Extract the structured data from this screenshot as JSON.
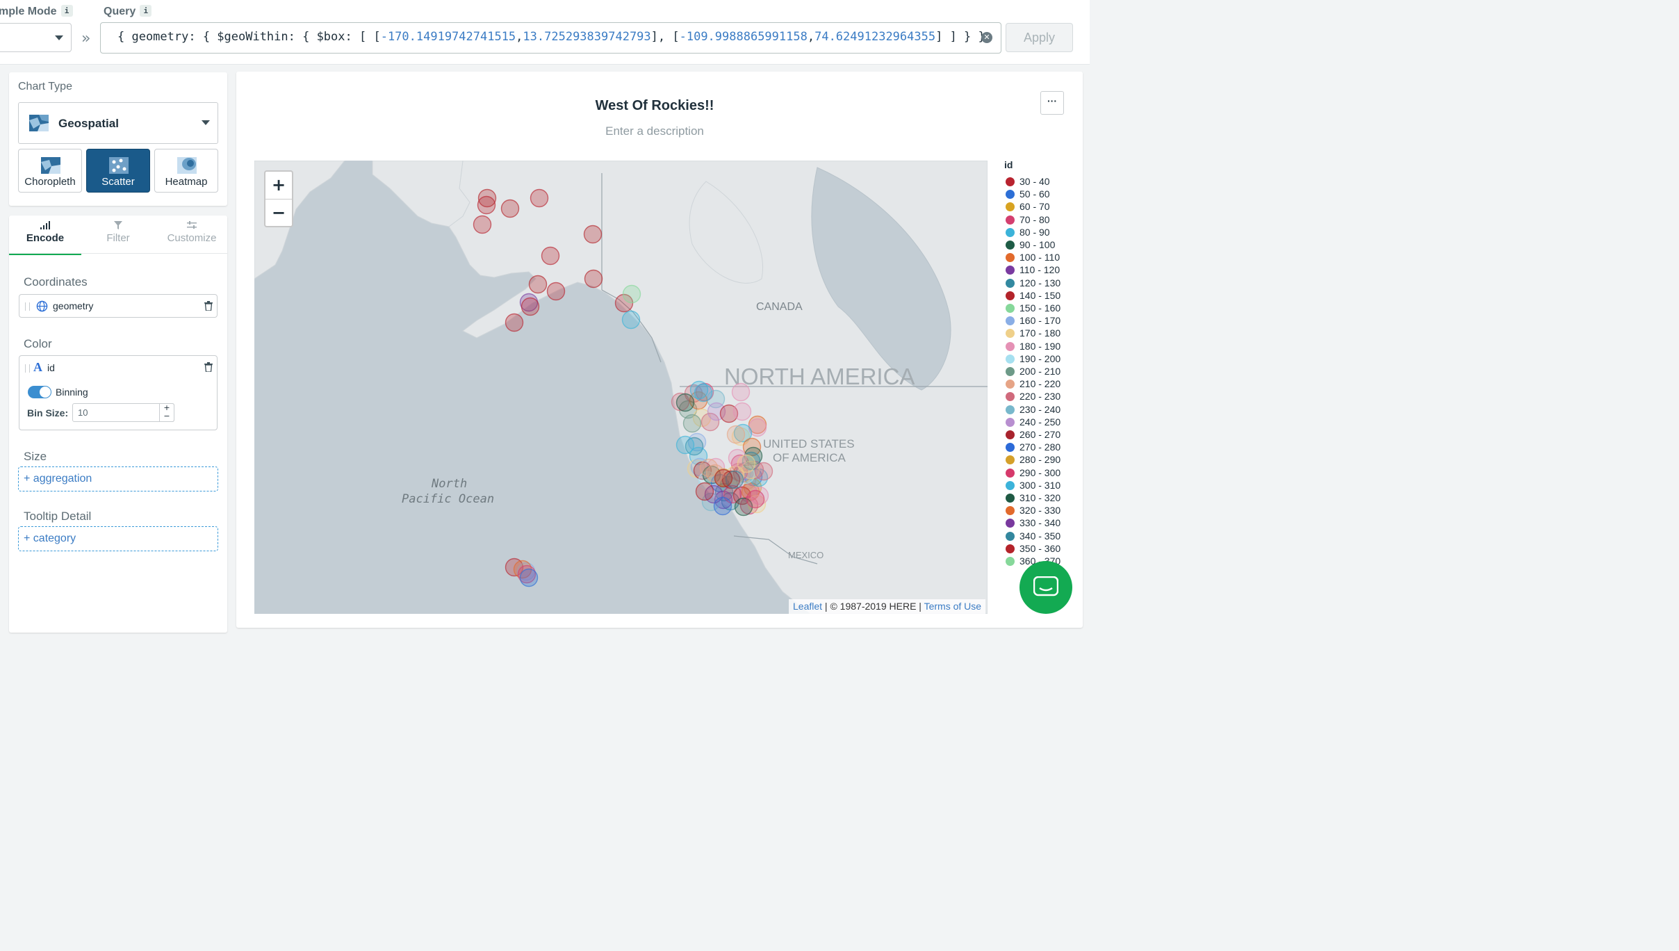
{
  "topbar": {
    "sample_mode_label": "mple Mode",
    "query_label": "Query",
    "info_glyph": "i",
    "query_text": "{ geometry: { $geoWithin: { $box: [ [",
    "query_num1": "-170.14919742741515",
    "query_num2": "13.725293839742793",
    "query_mid": "], [",
    "query_num3": "-109.9988865991158",
    "query_num4": "74.62491232964355",
    "query_end": "] ] } }",
    "apply_label": "Apply"
  },
  "chart_type": {
    "title": "Chart Type",
    "selected": "Geospatial",
    "options": [
      "Choropleth",
      "Scatter",
      "Heatmap"
    ],
    "active": "Scatter"
  },
  "tabs": [
    {
      "label": "Encode"
    },
    {
      "label": "Filter"
    },
    {
      "label": "Customize"
    }
  ],
  "encode": {
    "coordinates_title": "Coordinates",
    "coordinates_field": "geometry",
    "color_title": "Color",
    "color_field": "id",
    "binning_label": "Binning",
    "bin_size_label": "Bin Size:",
    "bin_size_value": "10",
    "size_title": "Size",
    "size_placeholder": "+ aggregation",
    "tooltip_title": "Tooltip Detail",
    "tooltip_placeholder": "+ category"
  },
  "chart": {
    "title": "West Of Rockies!!",
    "description_placeholder": "Enter a description",
    "more_label": "···",
    "map_labels": {
      "canada": "CANADA",
      "north_america": "NORTH AMERICA",
      "usa_1": "UNITED STATES",
      "usa_2": "OF AMERICA",
      "mexico": "MEXICO",
      "ocean_1": "North",
      "ocean_2": "Pacific Ocean"
    },
    "zoom_in": "+",
    "zoom_out": "−",
    "attribution_leaflet": "Leaflet",
    "attribution_here": " | © 1987-2019 HERE | ",
    "attribution_terms": "Terms of Use"
  },
  "legend": {
    "title": "id",
    "items": [
      {
        "label": "30 - 40",
        "color": "#b8232f"
      },
      {
        "label": "50 - 60",
        "color": "#2d6fd6"
      },
      {
        "label": "60 - 70",
        "color": "#d8a321"
      },
      {
        "label": "70 - 80",
        "color": "#d43f6f"
      },
      {
        "label": "80 - 90",
        "color": "#3bb3d9"
      },
      {
        "label": "90 - 100",
        "color": "#1f5c46"
      },
      {
        "label": "100 - 110",
        "color": "#e26a2c"
      },
      {
        "label": "110 - 120",
        "color": "#7a3aa0"
      },
      {
        "label": "120 - 130",
        "color": "#3389a0"
      },
      {
        "label": "140 - 150",
        "color": "#b3232a"
      },
      {
        "label": "150 - 160",
        "color": "#86d89a"
      },
      {
        "label": "160 - 170",
        "color": "#8aaee6"
      },
      {
        "label": "170 - 180",
        "color": "#efd08a"
      },
      {
        "label": "180 - 190",
        "color": "#e591b5"
      },
      {
        "label": "190 - 200",
        "color": "#a6e0f0"
      },
      {
        "label": "200 - 210",
        "color": "#6d9a88"
      },
      {
        "label": "210 - 220",
        "color": "#e6a486"
      },
      {
        "label": "220 - 230",
        "color": "#d06a7c"
      },
      {
        "label": "230 - 240",
        "color": "#78b8cc"
      },
      {
        "label": "240 - 250",
        "color": "#b88fd0"
      },
      {
        "label": "260 - 270",
        "color": "#a8232d"
      },
      {
        "label": "270 - 280",
        "color": "#2c6ad8"
      },
      {
        "label": "280 - 290",
        "color": "#d5a02a"
      },
      {
        "label": "290 - 300",
        "color": "#d63a6b"
      },
      {
        "label": "300 - 310",
        "color": "#3cb3da"
      },
      {
        "label": "310 - 320",
        "color": "#1f5a44"
      },
      {
        "label": "320 - 330",
        "color": "#e26a2c"
      },
      {
        "label": "330 - 340",
        "color": "#79399e"
      },
      {
        "label": "340 - 350",
        "color": "#33879e"
      },
      {
        "label": "350 - 360",
        "color": "#b4232a"
      },
      {
        "label": "360 - 370",
        "color": "#86d89a"
      }
    ]
  },
  "colors": {
    "accent_green": "#13aa52",
    "active_blue": "#1a5a8a",
    "link_blue": "#3b7cc4"
  }
}
